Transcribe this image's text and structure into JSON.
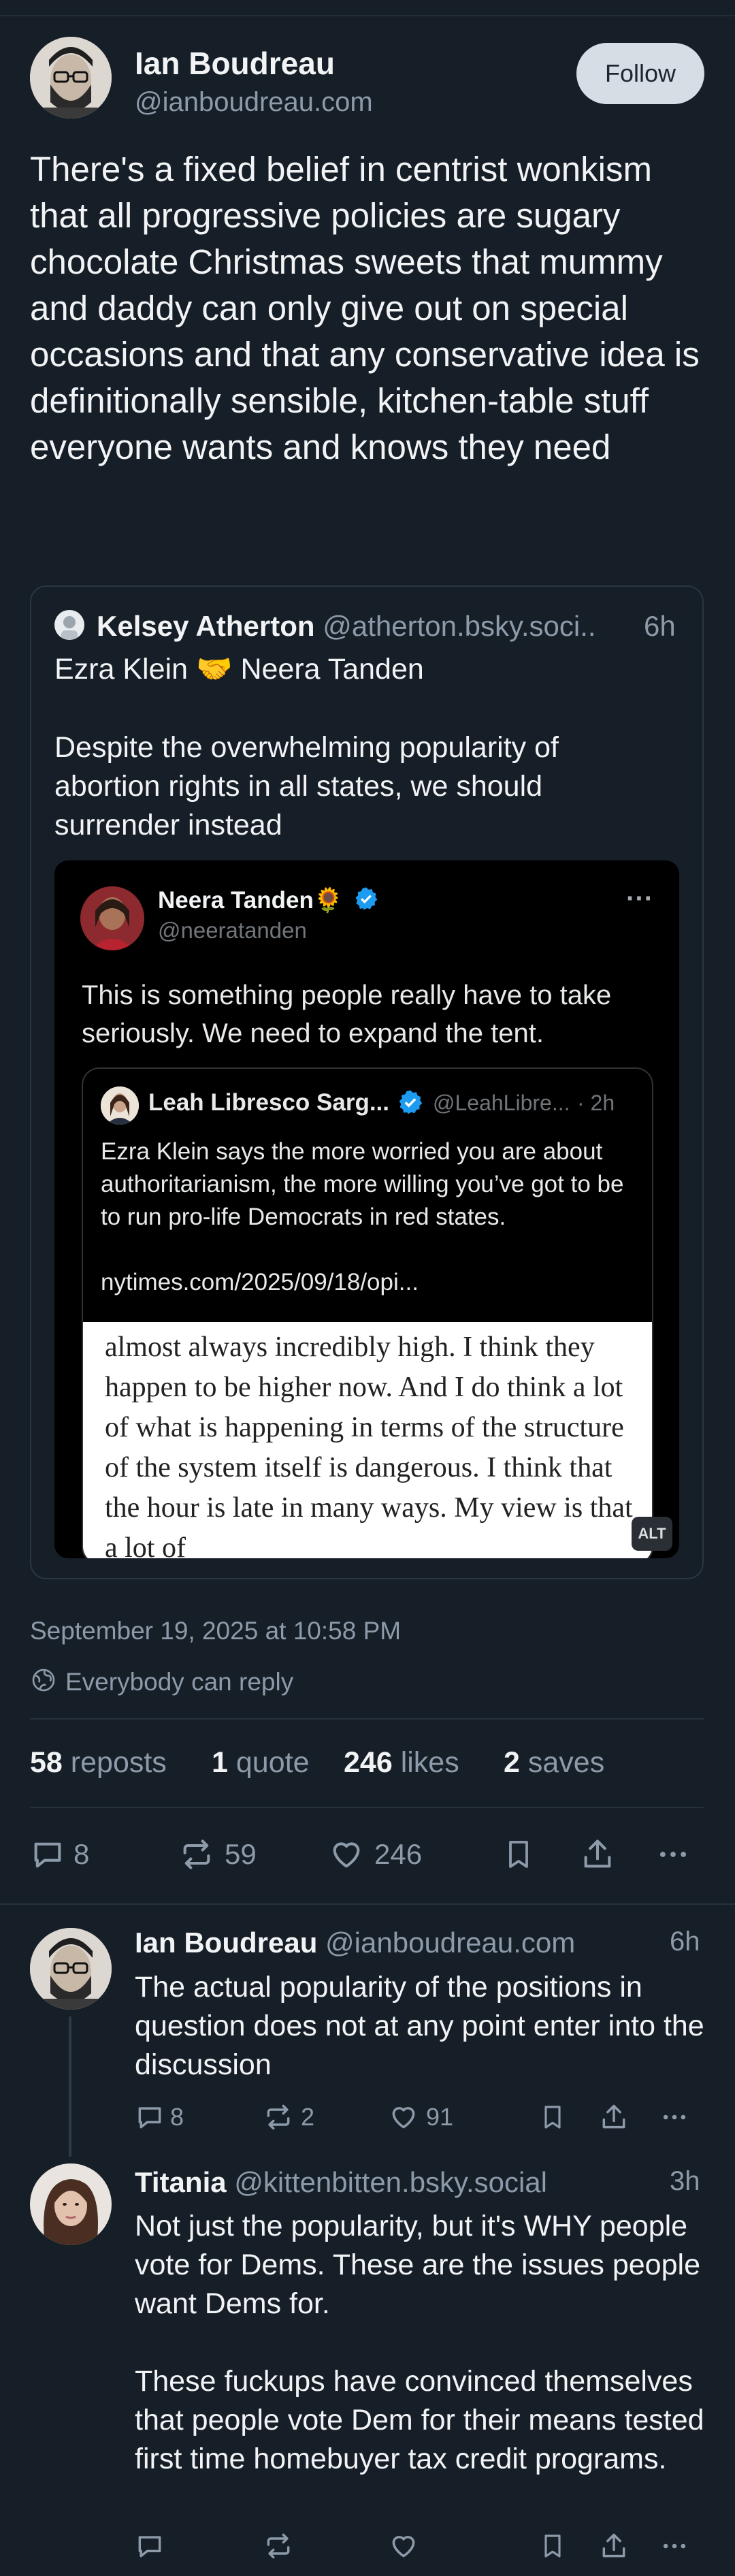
{
  "post": {
    "author_name": "Ian Boudreau",
    "author_handle": "@ianboudreau.com",
    "follow_label": "Follow",
    "text": "There's a fixed belief in centrist wonkism that all progressive policies are sugary chocolate Christmas sweets that mummy and daddy can only give out on special occasions and that any conservative idea is definitionally sensible, kitchen-table stuff everyone wants and knows they need",
    "timestamp": "September 19, 2025 at 10:58 PM",
    "reply_setting": "Everybody can reply",
    "stats": {
      "reposts_count": "58",
      "reposts_label": "reposts",
      "quote_count": "1",
      "quote_label": "quote",
      "likes_count": "246",
      "likes_label": "likes",
      "saves_count": "2",
      "saves_label": "saves"
    },
    "actions": {
      "replies": "8",
      "reposts": "59",
      "likes": "246"
    }
  },
  "quote": {
    "author_name": "Kelsey Atherton",
    "author_handle": "@atherton.bsky.soci..",
    "time": "6h",
    "line1_a": "Ezra Klein",
    "line1_emoji": "🤝",
    "line1_b": "Neera Tanden",
    "text": "Despite the overwhelming popularity of abortion rights in all states, we should surrender instead",
    "embed": {
      "author_name": "Neera Tanden",
      "name_emoji": "🌻",
      "author_handle": "@neeratanden",
      "more": "···",
      "text": "This is something people really have to take seriously.  We need to expand the tent.",
      "inner": {
        "author_name": "Leah Libresco Sarg...",
        "author_handle": "@LeahLibre...",
        "time": "· 2h",
        "text": "Ezra Klein says the more worried you are about authoritarianism, the more willing you’ve got to be to run pro-life Democrats in red states.",
        "link": "nytimes.com/2025/09/18/opi...",
        "article_text": "almost always incredibly high. I think they happen to be higher now. And I do think a lot of what is happening in terms of the structure of the system itself is dangerous. I think that the hour is late in many ways. My view is that a lot of"
      },
      "alt_badge": "ALT"
    }
  },
  "replies": [
    {
      "author_name": "Ian Boudreau",
      "author_handle": "@ianboudreau.com",
      "time": "6h",
      "text": "The actual popularity of the positions in question does not at any point enter into the discussion",
      "replies": "8",
      "reposts": "2",
      "likes": "91"
    },
    {
      "author_name": "Titania",
      "author_handle": "@kittenbitten.bsky.social",
      "time": "3h",
      "text_p1": "Not just the popularity, but it's WHY people vote for Dems. These are the issues people want Dems for.",
      "text_p2": "These fuckups have convinced themselves that people vote Dem for their means tested first time homebuyer tax credit programs."
    }
  ],
  "colors": {
    "background": "#161e27",
    "text": "#f1f3f5",
    "muted": "#8c9aa9",
    "verified": "#1d9bf0"
  }
}
